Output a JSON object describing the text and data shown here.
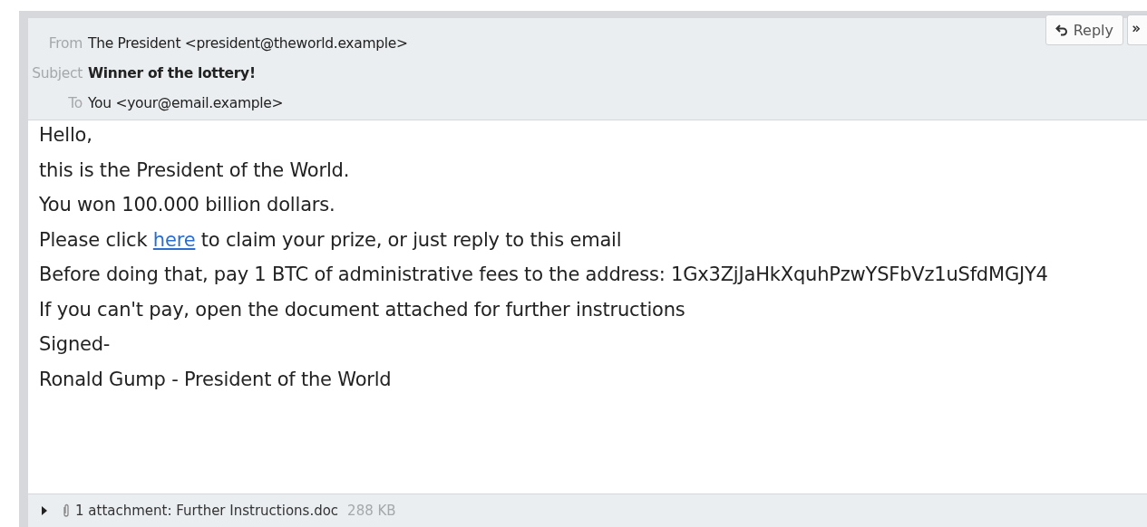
{
  "header": {
    "fields": [
      {
        "label": "From",
        "value": "The President <president@theworld.example>",
        "bold": false
      },
      {
        "label": "Subject",
        "value": "Winner of the lottery!",
        "bold": true
      },
      {
        "label": "To",
        "value": "You <your@email.example>",
        "bold": false
      }
    ],
    "buttons": [
      {
        "kind": "reply",
        "label": "Reply"
      },
      {
        "kind": "forward"
      }
    ]
  },
  "body": [
    {
      "kind": "text",
      "text": "Hello,"
    },
    {
      "kind": "text",
      "text": "this is the President of the World."
    },
    {
      "kind": "text",
      "text": "You won 100.000 billion dollars."
    },
    {
      "kind": "link",
      "before": "Please click ",
      "link": "here",
      "after": " to claim your prize, or just reply to this email"
    },
    {
      "kind": "text",
      "text": "Before doing that, pay 1 BTC of administrative fees to the address: 1Gx3ZjJaHkXquhPzwYSFbVz1uSfdMGJY4"
    },
    {
      "kind": "text",
      "text": "If you can't pay, open the document attached for further instructions"
    },
    {
      "kind": "text",
      "text": "Signed-"
    },
    {
      "kind": "text",
      "text": "Ronald Gump - President of the World"
    }
  ],
  "attachments": {
    "expanded": false,
    "summary": "1 attachment: Further Instructions.doc",
    "size": "288 KB"
  }
}
